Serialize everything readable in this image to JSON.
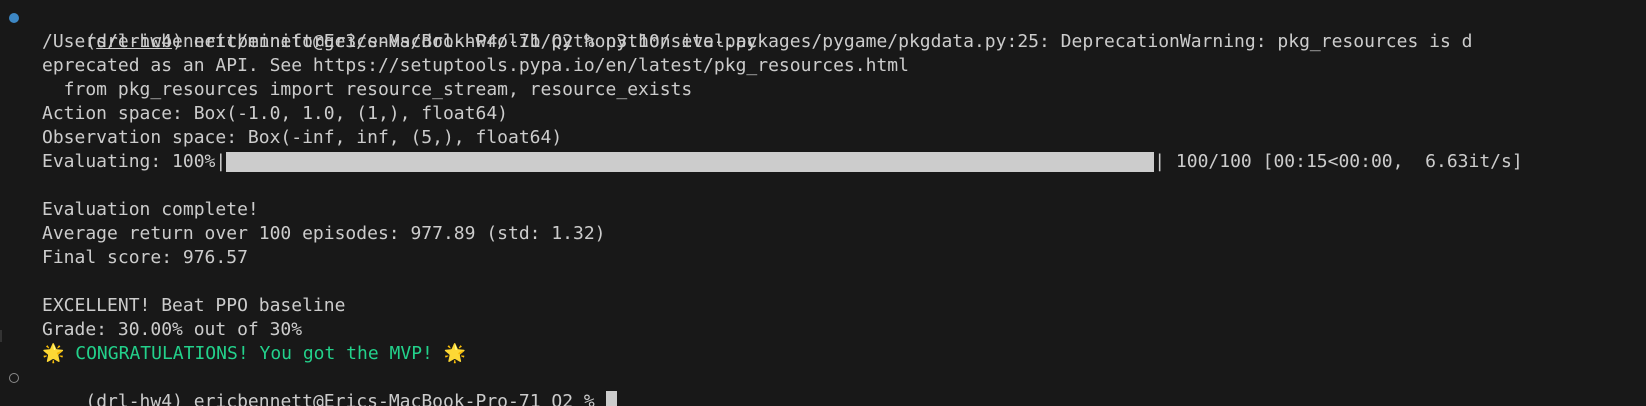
{
  "prompt": {
    "env": "drl-hw4",
    "host": "ericbennett@Erics-MacBook-Pro-71",
    "cwd": "Q2",
    "symbol": "%",
    "command": "python eval.py"
  },
  "output": {
    "warning_line1": "/Users/ericbennett/miniforge3/envs/drl-hw4/lib/python3.10/site-packages/pygame/pkgdata.py:25: DeprecationWarning: pkg_resources is d",
    "warning_line2": "eprecated as an API. See https://setuptools.pypa.io/en/latest/pkg_resources.html",
    "warning_line3": "  from pkg_resources import resource_stream, resource_exists",
    "action_space": "Action space: Box(-1.0, 1.0, (1,), float64)",
    "observation_space": "Observation space: Box(-inf, inf, (5,), float64)",
    "progress_label": "Evaluating: 100%|",
    "progress_fraction": 1.0,
    "progress_stats": "| 100/100 [00:15<00:00,  6.63it/s]",
    "eval_complete": "Evaluation complete!",
    "average_return": "Average return over 100 episodes: 977.89 (std: 1.32)",
    "final_score": "Final score: 976.57",
    "excellent": "EXCELLENT! Beat PPO baseline",
    "grade": "Grade: 30.00% out of 30%",
    "congrats_emoji": "🌟",
    "congrats_text": " CONGRATULATIONS! You got the MVP! "
  },
  "colors": {
    "background": "#181818",
    "text": "#cccccc",
    "success": "#23d18b",
    "active_dot": "#3d87c4"
  }
}
